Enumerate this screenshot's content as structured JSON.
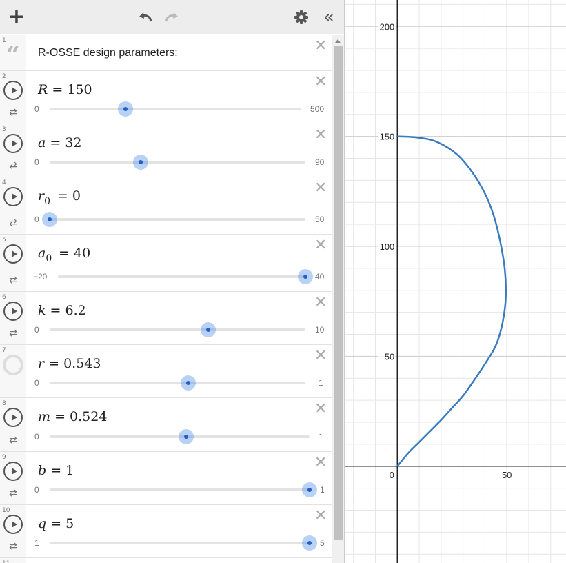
{
  "toolbar": {
    "add_icon": "plus-icon",
    "undo_icon": "undo-icon",
    "redo_icon": "redo-icon",
    "settings_icon": "gear-icon",
    "collapse_icon": "double-chevron-left-icon",
    "add_glyph": "+",
    "collapse_glyph": "«"
  },
  "expressions": [
    {
      "index": "1",
      "kind": "note",
      "text": "R-OSSE design parameters:"
    },
    {
      "index": "2",
      "kind": "slider",
      "var": "R",
      "sub": "",
      "value": "150",
      "min": "0",
      "max": "500",
      "position": 0.3
    },
    {
      "index": "3",
      "kind": "slider",
      "var": "a",
      "sub": "",
      "value": "32",
      "min": "0",
      "max": "90",
      "position": 0.356
    },
    {
      "index": "4",
      "kind": "slider",
      "var": "r",
      "sub": "0",
      "value": "0",
      "min": "0",
      "max": "50",
      "position": 0.0
    },
    {
      "index": "5",
      "kind": "slider",
      "var": "a",
      "sub": "0",
      "value": "40",
      "min": "−20",
      "max": "40",
      "position": 1.0
    },
    {
      "index": "6",
      "kind": "slider",
      "var": "k",
      "sub": "",
      "value": "6.2",
      "min": "0",
      "max": "10",
      "position": 0.62
    },
    {
      "index": "7",
      "kind": "slider",
      "var": "r",
      "sub": "",
      "value": "0.543",
      "min": "0",
      "max": "1",
      "position": 0.543,
      "paused_icon": true
    },
    {
      "index": "8",
      "kind": "slider",
      "var": "m",
      "sub": "",
      "value": "0.524",
      "min": "0",
      "max": "1",
      "position": 0.524
    },
    {
      "index": "9",
      "kind": "slider",
      "var": "b",
      "sub": "",
      "value": "1",
      "min": "0",
      "max": "1",
      "position": 1.0
    },
    {
      "index": "10",
      "kind": "slider",
      "var": "q",
      "sub": "",
      "value": "5",
      "min": "1",
      "max": "5",
      "position": 1.0
    },
    {
      "index": "11",
      "kind": "partial"
    }
  ],
  "icons": {
    "row_delete": "close-icon",
    "row_play": "play-icon",
    "row_loop": "loop-icon",
    "note": "quote-icon"
  },
  "graph": {
    "x_ticks": [
      "0",
      "50"
    ],
    "y_ticks": [
      "50",
      "100",
      "150",
      "200"
    ],
    "curve_color": "#3a7bc0",
    "grid_minor_color": "#e6e6e6",
    "grid_major_color": "#cccccc",
    "axis_color": "#222222"
  },
  "chart_data": {
    "type": "line",
    "title": "",
    "xlabel": "",
    "ylabel": "",
    "xlim": [
      -24,
      77
    ],
    "ylim": [
      -44,
      212
    ],
    "grid": true,
    "series": [
      {
        "points": [
          [
            0,
            0
          ],
          [
            5,
            6
          ],
          [
            10,
            11
          ],
          [
            15,
            16
          ],
          [
            20,
            21
          ],
          [
            25,
            26.5
          ],
          [
            30,
            32
          ],
          [
            35,
            39
          ],
          [
            40,
            46.5
          ],
          [
            45,
            55
          ],
          [
            48,
            65
          ],
          [
            49.5,
            77
          ],
          [
            49,
            90
          ],
          [
            47,
            102
          ],
          [
            44,
            114
          ],
          [
            40,
            124
          ],
          [
            34,
            134
          ],
          [
            27,
            142
          ],
          [
            18,
            147.5
          ],
          [
            9,
            149.5
          ],
          [
            0,
            150
          ]
        ]
      }
    ]
  }
}
